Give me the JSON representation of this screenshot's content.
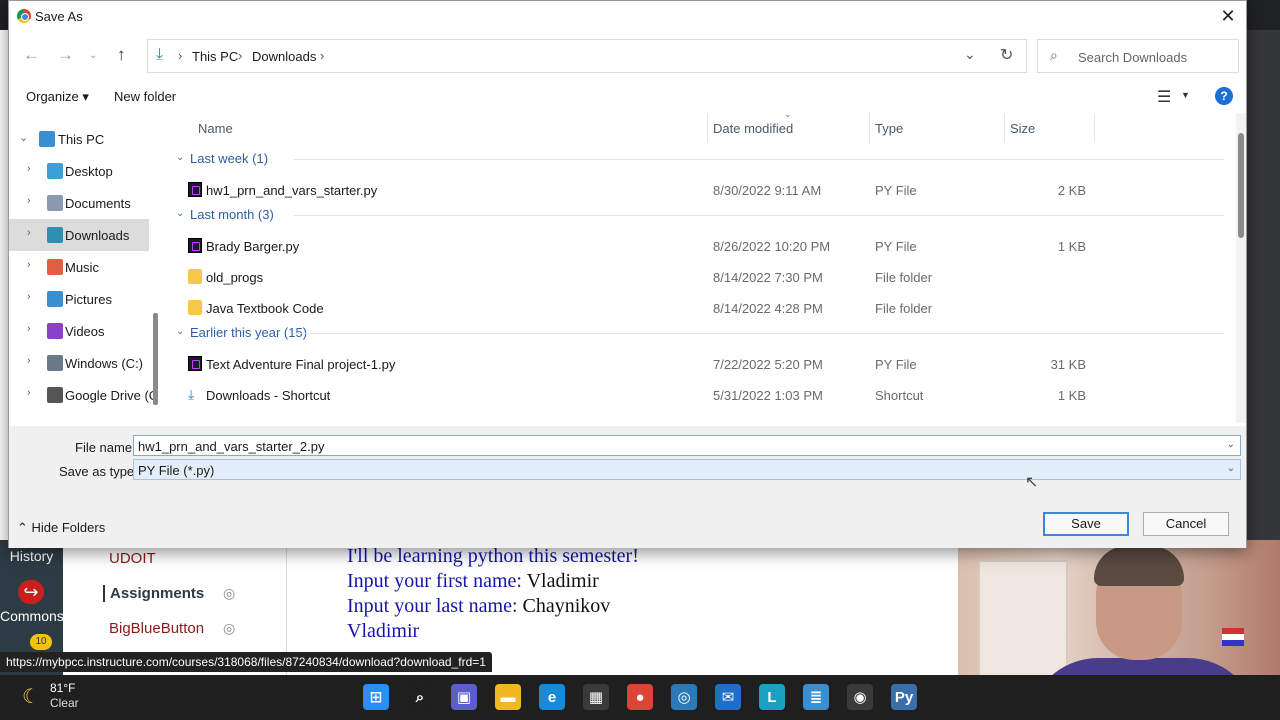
{
  "dialog": {
    "title": "Save As",
    "close_glyph": "✕",
    "breadcrumb": [
      "This PC",
      "Downloads"
    ],
    "search_placeholder": "Search Downloads",
    "toolbar": {
      "organize": "Organize ▾",
      "new_folder": "New folder",
      "help": "?"
    },
    "nav_pane": [
      {
        "label": "This PC",
        "icon": "computer-icon",
        "color": "#3a8fd0",
        "expanded": true
      },
      {
        "label": "Desktop",
        "icon": "desktop-icon",
        "color": "#3aa0d8"
      },
      {
        "label": "Documents",
        "icon": "documents-icon",
        "color": "#8a9ab0"
      },
      {
        "label": "Downloads",
        "icon": "downloads-icon",
        "color": "#2f8fb0",
        "selected": true
      },
      {
        "label": "Music",
        "icon": "music-icon",
        "color": "#e06040"
      },
      {
        "label": "Pictures",
        "icon": "pictures-icon",
        "color": "#3a8fd0"
      },
      {
        "label": "Videos",
        "icon": "videos-icon",
        "color": "#8a40c8"
      },
      {
        "label": "Windows (C:)",
        "icon": "drive-icon",
        "color": "#6a7a8a"
      },
      {
        "label": "Google Drive (G",
        "icon": "drive-icon",
        "color": "#555555"
      }
    ],
    "columns": {
      "name": "Name",
      "date": "Date modified",
      "type": "Type",
      "size": "Size"
    },
    "groups": [
      {
        "label": "Last week (1)",
        "rows": [
          {
            "name": "hw1_prn_and_vars_starter.py",
            "date": "8/30/2022 9:11 AM",
            "type": "PY File",
            "size": "2 KB",
            "icon": "py"
          }
        ]
      },
      {
        "label": "Last month (3)",
        "rows": [
          {
            "name": "Brady Barger.py",
            "date": "8/26/2022 10:20 PM",
            "type": "PY File",
            "size": "1 KB",
            "icon": "py"
          },
          {
            "name": "old_progs",
            "date": "8/14/2022 7:30 PM",
            "type": "File folder",
            "size": "",
            "icon": "folder"
          },
          {
            "name": "Java Textbook Code",
            "date": "8/14/2022 4:28 PM",
            "type": "File folder",
            "size": "",
            "icon": "folder"
          }
        ]
      },
      {
        "label": "Earlier this year (15)",
        "rows": [
          {
            "name": "Text Adventure Final project-1.py",
            "date": "7/22/2022 5:20 PM",
            "type": "PY File",
            "size": "31 KB",
            "icon": "py"
          },
          {
            "name": "Downloads - Shortcut",
            "date": "5/31/2022 1:03 PM",
            "type": "Shortcut",
            "size": "1 KB",
            "icon": "shortcut"
          }
        ]
      }
    ],
    "file_name_label": "File name:",
    "file_name_value": "hw1_prn_and_vars_starter_2.py",
    "save_type_label": "Save as type:",
    "save_type_value": "PY File (*.py)",
    "hide_folders": "Hide Folders",
    "save_label": "Save",
    "cancel_label": "Cancel"
  },
  "background": {
    "canvas_nav": {
      "history": "History",
      "commons": "Commons",
      "badge": "10"
    },
    "course_nav": [
      "UDOIT",
      "Assignments",
      "BigBlueButton"
    ],
    "code_output": [
      {
        "text": "I'll be learning python this semester!",
        "input": ""
      },
      {
        "text": "Input your first name: ",
        "input": "Vladimir"
      },
      {
        "text": "Input your last name: ",
        "input": "Chaynikov"
      },
      {
        "text": "Vladimir",
        "input": ""
      }
    ],
    "status_url": "https://mybpcc.instructure.com/courses/318068/files/87240834/download?download_frd=1"
  },
  "taskbar": {
    "temperature": "81°F",
    "condition": "Clear",
    "apps": [
      {
        "name": "windows-start-icon",
        "glyph": "⊞",
        "color": "#2b8ef0"
      },
      {
        "name": "search-icon",
        "glyph": "⌕",
        "color": "#1f1f1f"
      },
      {
        "name": "teams-chat-icon",
        "glyph": "▣",
        "color": "#5b5fc7"
      },
      {
        "name": "file-explorer-icon",
        "glyph": "▬",
        "color": "#f2b824"
      },
      {
        "name": "edge-icon",
        "glyph": "e",
        "color": "#1a8ad4"
      },
      {
        "name": "store-icon",
        "glyph": "▦",
        "color": "#3a3a3a"
      },
      {
        "name": "chrome-icon",
        "glyph": "●",
        "color": "#db4437"
      },
      {
        "name": "webcam-app-icon",
        "glyph": "◎",
        "color": "#2a7ab8"
      },
      {
        "name": "mail-icon",
        "glyph": "✉",
        "color": "#1f6fc6"
      },
      {
        "name": "l-app-icon",
        "glyph": "L",
        "color": "#1aa0c0"
      },
      {
        "name": "notepad-icon",
        "glyph": "≣",
        "color": "#3a8fd0"
      },
      {
        "name": "obs-icon",
        "glyph": "◉",
        "color": "#3a3a3a"
      },
      {
        "name": "python-icon",
        "glyph": "Py",
        "color": "#3a6ea8"
      }
    ]
  }
}
